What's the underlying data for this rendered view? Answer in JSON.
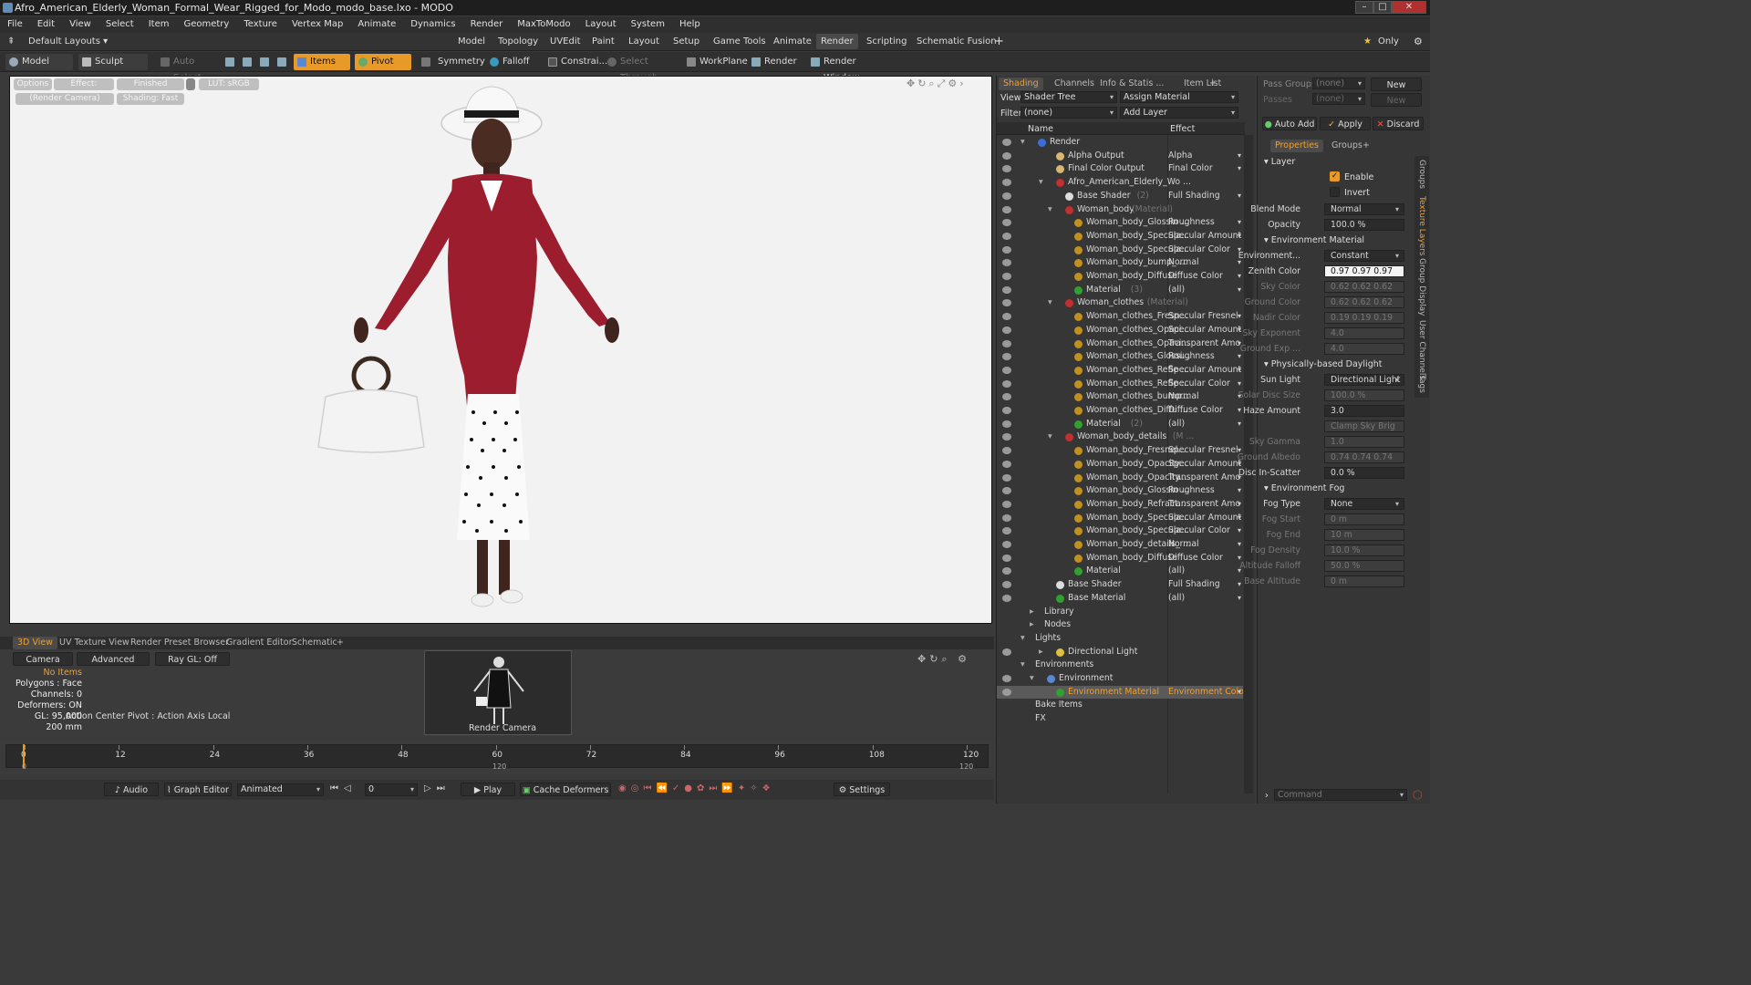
{
  "window": {
    "title": "Afro_American_Elderly_Woman_Formal_Wear_Rigged_for_Modo_modo_base.lxo - MODO",
    "buttons": [
      "–",
      "□",
      "✕"
    ]
  },
  "menu": [
    "File",
    "Edit",
    "View",
    "Select",
    "Item",
    "Geometry",
    "Texture",
    "Vertex Map",
    "Animate",
    "Dynamics",
    "Render",
    "MaxToModo",
    "Layout",
    "System",
    "Help"
  ],
  "layoutbar": {
    "layout": "Default Layouts ▾",
    "tabs": [
      "Model",
      "Topology",
      "UVEdit",
      "Paint",
      "Layout",
      "Setup",
      "Game Tools",
      "Animate",
      "Render",
      "Scripting",
      "Schematic Fusion",
      "+"
    ],
    "active": "Render",
    "only": "Only"
  },
  "toolbar": {
    "model": "Model",
    "sculpt": "Sculpt",
    "auto_select": "Auto Select",
    "items": "Items",
    "pivot": "Pivot",
    "symmetry": "Symmetry",
    "falloff": "Falloff",
    "constrain": "Constrai...",
    "select_through": "Select Through",
    "workplane": "WorkPlane",
    "render": "Render",
    "render_window": "Render Window"
  },
  "viewport": {
    "options": "Options",
    "effect": "Effect: (Shadi...",
    "finished": "Finished",
    "lut": "LUT: sRGB",
    "camera": "(Render Camera)",
    "shading": "Shading: Fast"
  },
  "shading": {
    "tabs": [
      "Shading",
      "Channels",
      "Info & Statis ...",
      "Item List",
      "+"
    ],
    "view_label": "View",
    "view_value": "Shader Tree",
    "assign": "Assign Material",
    "filter_label": "Filter",
    "filter_value": "(none)",
    "add_layer": "Add Layer",
    "col_name": "Name",
    "col_effect": "Effect",
    "rows": [
      {
        "n": "Render",
        "e": "",
        "d": 0,
        "i": "#3c6dd6"
      },
      {
        "n": "Alpha Output",
        "e": "Alpha",
        "d": 2,
        "i": "#d8b870"
      },
      {
        "n": "Final Color Output",
        "e": "Final Color",
        "d": 2,
        "i": "#d8b870"
      },
      {
        "n": "Afro_American_Elderly_Wo ...",
        "e": "",
        "d": 2,
        "i": "#c03030"
      },
      {
        "n": "Base Shader",
        "s": "(2)",
        "e": "Full Shading",
        "d": 3,
        "i": "#dddddd"
      },
      {
        "n": "Woman_body",
        "s": "(Material)",
        "e": "",
        "d": 3,
        "i": "#c03030"
      },
      {
        "n": "Woman_body_Glossin ...",
        "e": "Roughness",
        "d": 4,
        "i": "#c09020"
      },
      {
        "n": "Woman_body_Specula...",
        "e": "Specular Amount",
        "d": 4,
        "i": "#c09020"
      },
      {
        "n": "Woman_body_Specula...",
        "e": "Specular Color",
        "d": 4,
        "i": "#c09020"
      },
      {
        "n": "Woman_body_bump_ ...",
        "e": "Normal",
        "d": 4,
        "i": "#c09020"
      },
      {
        "n": "Woman_body_Diffuse",
        "e": "Diffuse Color",
        "d": 4,
        "i": "#c09020"
      },
      {
        "n": "Material",
        "s": "(3)",
        "e": "(all)",
        "d": 4,
        "i": "#30a030"
      },
      {
        "n": "Woman_clothes",
        "s": "(Material)",
        "e": "",
        "d": 3,
        "i": "#c03030"
      },
      {
        "n": "Woman_clothes_Fresn...",
        "e": "Specular Fresnel",
        "d": 4,
        "i": "#c09020"
      },
      {
        "n": "Woman_clothes_Opaci...",
        "e": "Specular Amount",
        "d": 4,
        "i": "#c09020"
      },
      {
        "n": "Woman_clothes_Opaci...",
        "e": "Transparent Amo ...",
        "d": 4,
        "i": "#c09020"
      },
      {
        "n": "Woman_clothes_Glossi...",
        "e": "Roughness",
        "d": 4,
        "i": "#c09020"
      },
      {
        "n": "Woman_clothes_Refle ...",
        "e": "Specular Amount",
        "d": 4,
        "i": "#c09020"
      },
      {
        "n": "Woman_clothes_Refle ...",
        "e": "Specular Color",
        "d": 4,
        "i": "#c09020"
      },
      {
        "n": "Woman_clothes_bump...",
        "e": "Normal",
        "d": 4,
        "i": "#c09020"
      },
      {
        "n": "Woman_clothes_Diffu ...",
        "e": "Diffuse Color",
        "d": 4,
        "i": "#c09020"
      },
      {
        "n": "Material",
        "s": "(2)",
        "e": "(all)",
        "d": 4,
        "i": "#30a030"
      },
      {
        "n": "Woman_body_details",
        "s": "(M ...",
        "e": "",
        "d": 3,
        "i": "#c03030"
      },
      {
        "n": "Woman_body_Fresnel...",
        "e": "Specular Fresnel",
        "d": 4,
        "i": "#c09020"
      },
      {
        "n": "Woman_body_Opacity...",
        "e": "Specular Amount",
        "d": 4,
        "i": "#c09020"
      },
      {
        "n": "Woman_body_Opacity...",
        "e": "Transparent Amo ...",
        "d": 4,
        "i": "#c09020"
      },
      {
        "n": "Woman_body_Glossin ...",
        "e": "Roughness",
        "d": 4,
        "i": "#c09020"
      },
      {
        "n": "Woman_body_Refract...",
        "e": "Transparent Amo ...",
        "d": 4,
        "i": "#c09020"
      },
      {
        "n": "Woman_body_Specula...",
        "e": "Specular Amount",
        "d": 4,
        "i": "#c09020"
      },
      {
        "n": "Woman_body_Specula...",
        "e": "Specular Color",
        "d": 4,
        "i": "#c09020"
      },
      {
        "n": "Woman_body_details_ ...",
        "e": "Normal",
        "d": 4,
        "i": "#c09020"
      },
      {
        "n": "Woman_body_Diffuse",
        "e": "Diffuse Color",
        "d": 4,
        "i": "#c09020"
      },
      {
        "n": "Material",
        "e": "(all)",
        "d": 4,
        "i": "#30a030"
      },
      {
        "n": "Base Shader",
        "e": "Full Shading",
        "d": 2,
        "i": "#dddddd"
      },
      {
        "n": "Base Material",
        "e": "(all)",
        "d": 2,
        "i": "#30a030"
      },
      {
        "n": "Library",
        "e": "",
        "d": 1,
        "i": ""
      },
      {
        "n": "Nodes",
        "e": "",
        "d": 1,
        "i": ""
      },
      {
        "n": "Lights",
        "e": "",
        "d": 0,
        "i": ""
      },
      {
        "n": "Directional Light",
        "e": "",
        "d": 2,
        "i": "#e0c040"
      },
      {
        "n": "Environments",
        "e": "",
        "d": 0,
        "i": ""
      },
      {
        "n": "Environment",
        "e": "",
        "d": 1,
        "i": "#5a88d0"
      },
      {
        "n": "Environment Material",
        "e": "Environment Color",
        "d": 2,
        "i": "#30a030",
        "sel": true
      },
      {
        "n": "Bake Items",
        "e": "",
        "d": 0,
        "i": ""
      },
      {
        "n": "FX",
        "e": "",
        "d": 0,
        "i": ""
      }
    ]
  },
  "props": {
    "pass_groups": "Pass Groups",
    "none1": "(none)",
    "new": "New",
    "passes": "Passes",
    "none2": "(none)",
    "new2": "New",
    "auto_add": "Auto Add",
    "apply": "Apply",
    "discard": "Discard",
    "tabs": [
      "Properties",
      "Groups",
      "+"
    ],
    "layer": "Layer",
    "enable": "Enable",
    "invert": "Invert",
    "rows": [
      {
        "l": "Blend Mode",
        "v": "Normal",
        "dd": true
      },
      {
        "l": "Opacity",
        "v": "100.0 %"
      },
      {
        "sect": "Environment Material"
      },
      {
        "l": "Environment...",
        "v": "Constant",
        "dd": true
      },
      {
        "l": "Zenith Color",
        "v": "0.97  0.97  0.97",
        "white": true
      },
      {
        "l": "Sky Color",
        "v": "0.62  0.62  0.62",
        "dis": true
      },
      {
        "l": "Ground Color",
        "v": "0.62  0.62  0.62",
        "dis": true
      },
      {
        "l": "Nadir Color",
        "v": "0.19  0.19  0.19",
        "dis": true
      },
      {
        "l": "Sky Exponent",
        "v": "4.0",
        "dis": true
      },
      {
        "l": "Ground Exp ...",
        "v": "4.0",
        "dis": true
      },
      {
        "sect": "Physically-based Daylight"
      },
      {
        "l": "Sun Light",
        "v": "Directional Light",
        "dd": true
      },
      {
        "l": "Solar Disc Size",
        "v": "100.0 %",
        "dis": true
      },
      {
        "l": "Haze Amount",
        "v": "3.0"
      },
      {
        "l": "",
        "v": "Clamp Sky Brig ...",
        "dis": true
      },
      {
        "l": "Sky Gamma",
        "v": "1.0",
        "dis": true
      },
      {
        "l": "Ground Albedo",
        "v": "0.74  0.74  0.74",
        "dis": true
      },
      {
        "l": "Disc In-Scatter",
        "v": "0.0 %"
      },
      {
        "sect": "Environment Fog"
      },
      {
        "l": "Fog Type",
        "v": "None",
        "dd": true
      },
      {
        "l": "Fog Start",
        "v": "0 m",
        "dis": true
      },
      {
        "l": "Fog End",
        "v": "10 m",
        "dis": true
      },
      {
        "l": "Fog Density",
        "v": "10.0 %",
        "dis": true
      },
      {
        "l": "Altitude Falloff",
        "v": "50.0 %",
        "dis": true
      },
      {
        "l": "Base Altitude",
        "v": "0 m",
        "dis": true
      }
    ],
    "side_tabs": [
      "Groups",
      "Texture Layers",
      "Group Display",
      "User Channels",
      "Tags"
    ],
    "command": "Command"
  },
  "bottom": {
    "tabs": [
      "3D View",
      "UV Texture View",
      "Render Preset Browser",
      "Gradient Editor",
      "Schematic",
      "+"
    ],
    "camera": "Camera",
    "advanced": "Advanced",
    "raygl": "Ray GL: Off",
    "action_center": "Action Center Pivot : Action Axis Local",
    "render_camera": "Render Camera",
    "stats": [
      "No Items",
      "Polygons : Face",
      "Channels: 0",
      "Deformers: ON",
      "GL: 95,000",
      "200 mm"
    ],
    "ticks": [
      "0",
      "12",
      "24",
      "36",
      "48",
      "60",
      "72",
      "84",
      "96",
      "108",
      "120"
    ],
    "ticks2": [
      "0",
      "120",
      "120"
    ]
  },
  "transport": {
    "audio": "Audio",
    "graph_editor": "Graph Editor",
    "animated": "Animated",
    "frame": "0",
    "play": "Play",
    "cache": "Cache Deformers",
    "settings": "Settings"
  }
}
